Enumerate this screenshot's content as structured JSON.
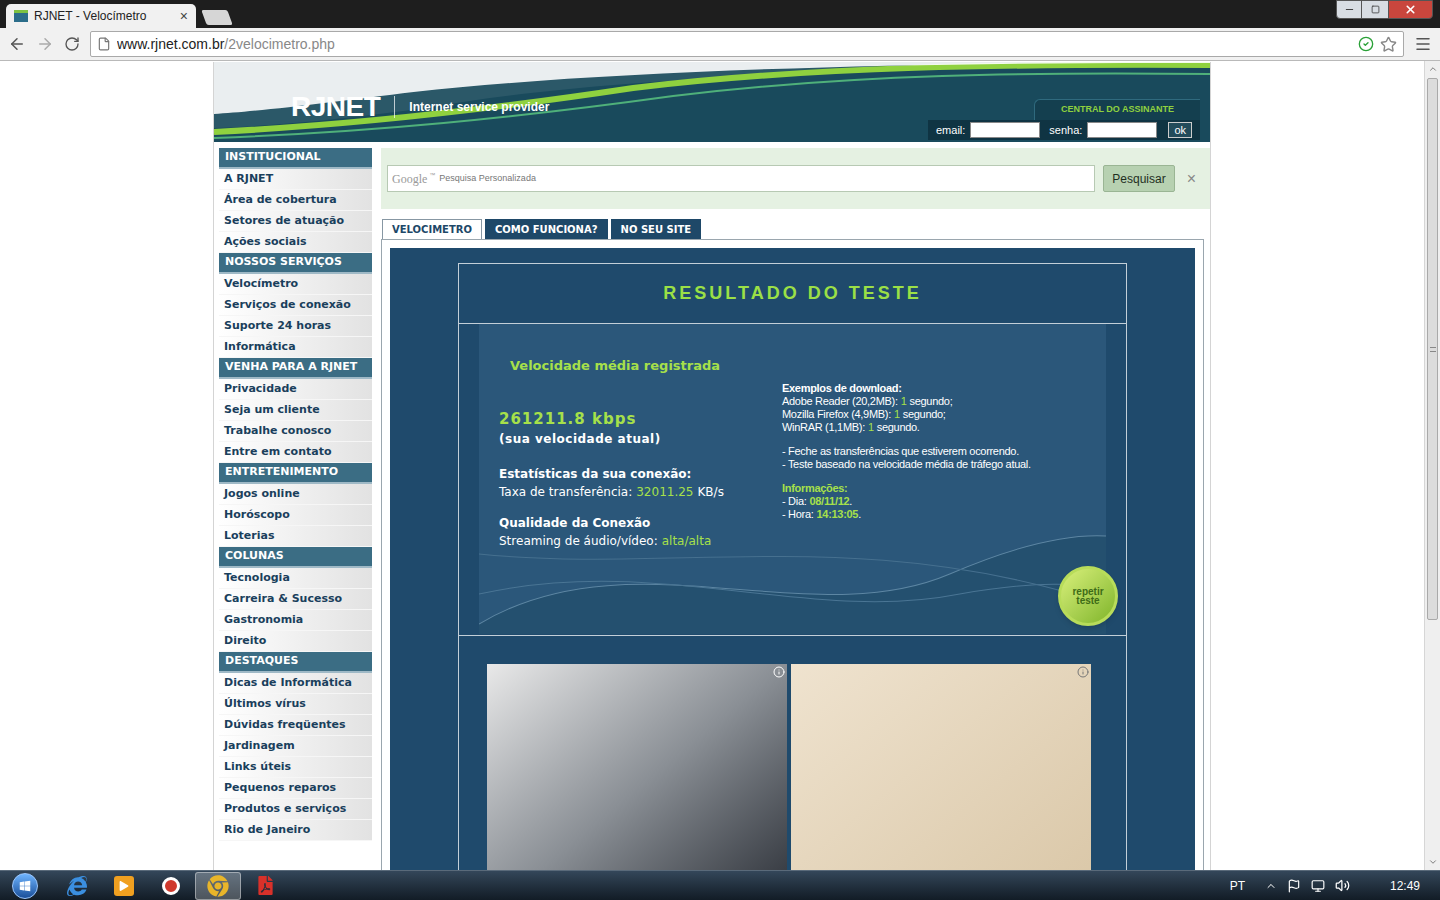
{
  "browser": {
    "tabs": [
      {
        "title": "RJNET - Velocímetro",
        "close": "×",
        "selected": true
      }
    ],
    "url_host": "www.rjnet.com.br",
    "url_path": "/2velocimetro.php",
    "bookmarked": false
  },
  "header": {
    "logo": "RJNET",
    "tagline": "Internet service provider",
    "login_title": "CENTRAL DO ASSINANTE",
    "email_label": "email:",
    "password_label": "senha:",
    "submit": "ok"
  },
  "sidebar": {
    "sections": [
      {
        "title": "INSTITUCIONAL",
        "items": [
          "A RJNET",
          "Área de cobertura",
          "Setores de atuação",
          "Ações sociais"
        ]
      },
      {
        "title": "NOSSOS SERVIÇOS",
        "items": [
          "Velocímetro",
          "Serviços de conexão",
          "Suporte 24 horas",
          "Informática"
        ]
      },
      {
        "title": "VENHA PARA A RJNET",
        "items": [
          "Privacidade",
          "Seja um cliente",
          "Trabalhe conosco",
          "Entre em contato"
        ]
      },
      {
        "title": "ENTRETENIMENTO",
        "items": [
          "Jogos online",
          "Horóscopo",
          "Loterias"
        ]
      },
      {
        "title": "COLUNAS",
        "items": [
          "Tecnologia",
          "Carreira & Sucesso",
          "Gastronomia",
          "Direito"
        ]
      },
      {
        "title": "DESTAQUES",
        "items": [
          "Dicas de Informática",
          "Últimos vírus",
          "Dúvidas freqüentes",
          "Jardinagem",
          "Links úteis",
          "Pequenos reparos",
          "Produtos e serviços",
          "Rio de Janeiro"
        ]
      }
    ]
  },
  "search": {
    "brand": "Google",
    "brand_mark": "™",
    "placeholder": "Pesquisa Personalizada",
    "button": "Pesquisar",
    "clear": "×"
  },
  "content_tabs": [
    {
      "label": "VELOCIMETRO",
      "selected": true
    },
    {
      "label": "COMO FUNCIONA?",
      "selected": false
    },
    {
      "label": "NO SEU SITE",
      "selected": false
    }
  ],
  "result": {
    "title": "RESULTADO DO TESTE",
    "velocity_title": "Velocidade média registrada",
    "speed": "261211.8 kbps",
    "speed_note": "(sua velocidade atual)",
    "stats_title": "Estatísticas da sua conexão:",
    "transfer_label": "Taxa de transferência:",
    "transfer_value": "32011.25",
    "transfer_unit": "KB/s",
    "quality_title": "Qualidade da Conexão",
    "streaming_label": "Streaming de áudio/vídeo:",
    "streaming_value": "alta/alta",
    "examples_title": "Exemplos de download:",
    "examples": [
      {
        "name": "Adobe Reader (20,2MB):",
        "value": "1",
        "unit": "segundo;"
      },
      {
        "name": "Mozilla Firefox (4,9MB):",
        "value": "1",
        "unit": "segundo;"
      },
      {
        "name": "WinRAR (1,1MB):",
        "value": "1",
        "unit": "segundo."
      }
    ],
    "notes": [
      "- Feche as transferências que estiverem ocorrendo.",
      "- Teste baseado na velocidade média de tráfego atual."
    ],
    "info_title": "Informações:",
    "info": [
      {
        "label": "- Dia:",
        "value": "08/11/12",
        "end": "."
      },
      {
        "label": "- Hora:",
        "value": "14:13:05",
        "end": "."
      }
    ],
    "retest": "repetir teste"
  },
  "taskbar": {
    "apps": [
      {
        "kind": "ie",
        "active": false
      },
      {
        "kind": "media",
        "active": false
      },
      {
        "kind": "app",
        "active": false
      },
      {
        "kind": "chrome",
        "active": true
      },
      {
        "kind": "pdf",
        "active": false
      }
    ],
    "language": "PT",
    "clock": "12:49"
  }
}
